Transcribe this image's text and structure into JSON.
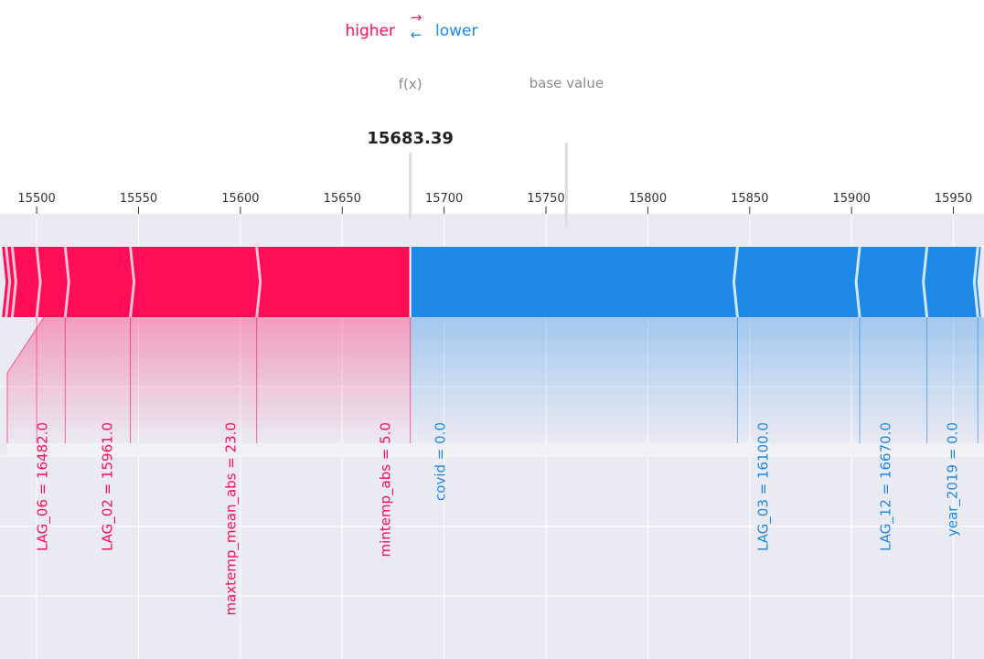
{
  "chart_data": {
    "type": "force_plot",
    "legend": {
      "higher": "higher",
      "lower": "lower",
      "higher_arrow": "→",
      "lower_arrow": "←"
    },
    "output_label": "f(x)",
    "base_label": "base value",
    "output_value": 15683.39,
    "output_value_text": "15683.39",
    "base_value": 15760,
    "xlim": [
      15482,
      15965
    ],
    "ticks": [
      15500,
      15550,
      15600,
      15650,
      15700,
      15750,
      15800,
      15850,
      15900,
      15950
    ],
    "tick_labels": [
      "15500",
      "15550",
      "15600",
      "15650",
      "15700",
      "15750",
      "15800",
      "15850",
      "15900",
      "15950"
    ],
    "grid": true,
    "positive_features": [
      {
        "label": "mintemp_abs = 5.0",
        "from": 15608,
        "to": 15683.39
      },
      {
        "label": "maxtemp_mean_abs = 23.0",
        "from": 15546,
        "to": 15608
      },
      {
        "label": "LAG_02 = 15961.0",
        "from": 15514,
        "to": 15546
      },
      {
        "label": "LAG_06 = 16482.0",
        "from": 15500,
        "to": 15514
      },
      {
        "label": "",
        "from": 15488,
        "to": 15500
      },
      {
        "label": "",
        "from": 15485,
        "to": 15488
      },
      {
        "label": "",
        "from": 15483,
        "to": 15485
      }
    ],
    "negative_features": [
      {
        "label": "covid = 0.0",
        "from": 15683.39,
        "to": 15844
      },
      {
        "label": "LAG_03 = 16100.0",
        "from": 15844,
        "to": 15904
      },
      {
        "label": "LAG_12 = 16670.0",
        "from": 15904,
        "to": 15937
      },
      {
        "label": "year_2019 = 0.0",
        "from": 15937,
        "to": 15962
      },
      {
        "label": "",
        "from": 15962,
        "to": 15963.5
      }
    ],
    "colors": {
      "positive": "#ff0d57",
      "negative": "#1e88e5",
      "background": "#eaeaf2",
      "grid": "#ffffff",
      "axis_text": "#333333",
      "muted_text": "#8c8c8c"
    }
  }
}
